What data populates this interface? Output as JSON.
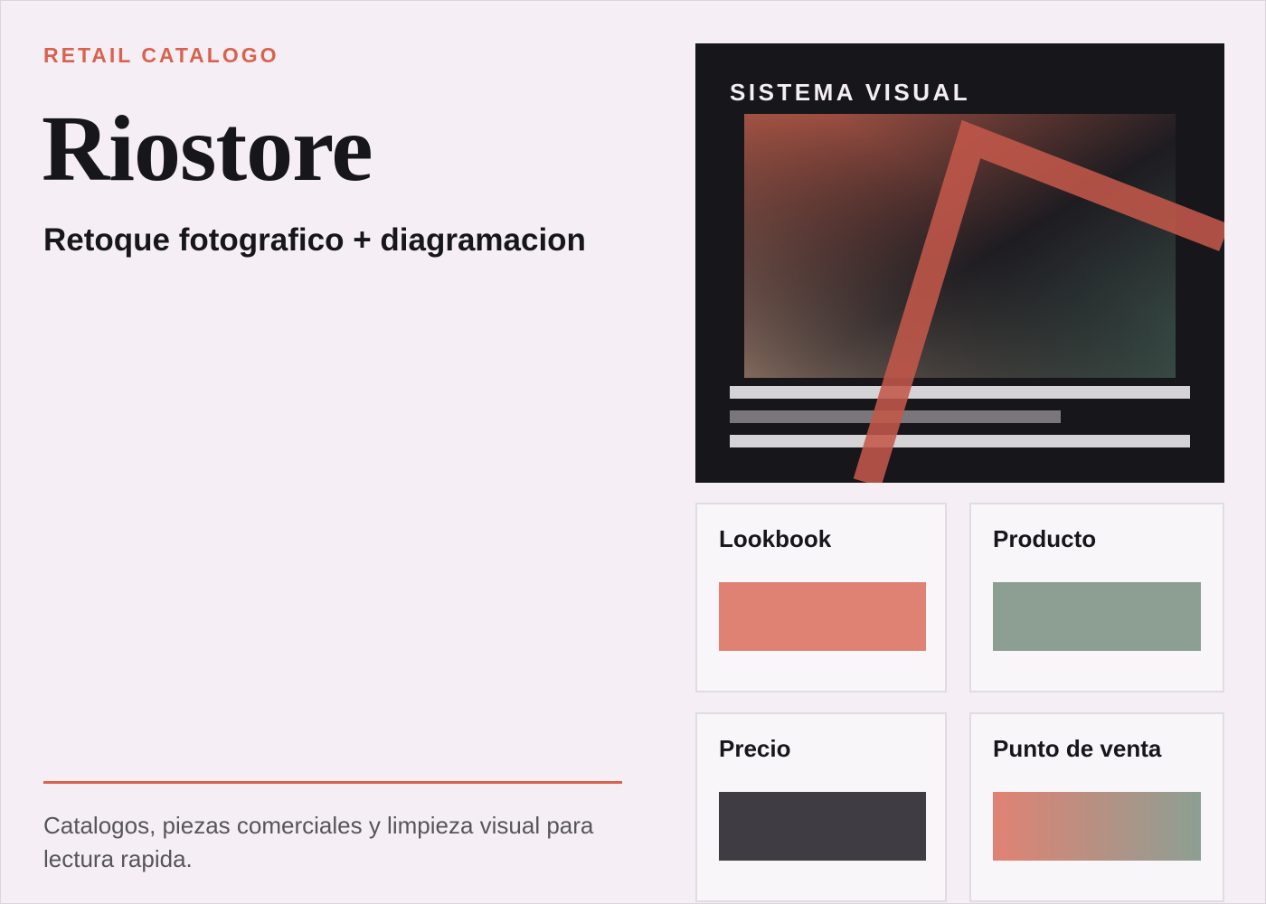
{
  "header": {
    "eyebrow": "RETAIL CATALOGO",
    "title": "Riostore",
    "subtitle": "Retoque fotografico + diagramacion"
  },
  "description": "Catalogos, piezas comerciales y limpieza visual para lectura rapida.",
  "visual": {
    "label": "SISTEMA VISUAL"
  },
  "colors": {
    "background": "#f5eff5",
    "accent": "#d9624e",
    "dark": "#17161b",
    "coral": "#e08273",
    "sage": "#8d9f93",
    "charcoal": "#3f3d43"
  },
  "cards": [
    {
      "title": "Lookbook",
      "swatch": "#e08273"
    },
    {
      "title": "Producto",
      "swatch": "#8d9f93"
    },
    {
      "title": "Precio",
      "swatch": "#3f3d43"
    },
    {
      "title": "Punto de venta",
      "swatch": "linear-gradient(90deg, #e08273, #8d9f93)"
    }
  ]
}
